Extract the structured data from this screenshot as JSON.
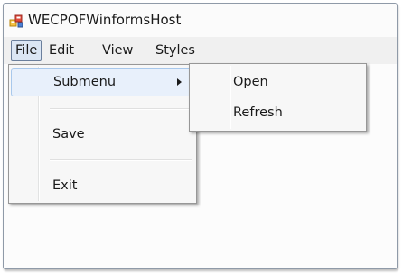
{
  "window": {
    "title": "WECPOFWinformsHost",
    "icon": "app-window-icon"
  },
  "menubar": {
    "items": [
      {
        "label": "File",
        "active": true
      },
      {
        "label": "Edit"
      },
      {
        "label": "View"
      },
      {
        "label": "Styles"
      }
    ]
  },
  "file_menu": {
    "items": [
      {
        "label": "Submenu",
        "highlighted": true,
        "has_submenu": true
      },
      {
        "label": "Save"
      },
      {
        "label": "Exit"
      }
    ]
  },
  "submenu": {
    "items": [
      {
        "label": "Open"
      },
      {
        "label": "Refresh"
      }
    ]
  },
  "colors": {
    "menu_highlight": "#e8f0fb",
    "menu_highlight_border": "#a8c8ec",
    "active_menu_border": "#6b7f9c"
  }
}
